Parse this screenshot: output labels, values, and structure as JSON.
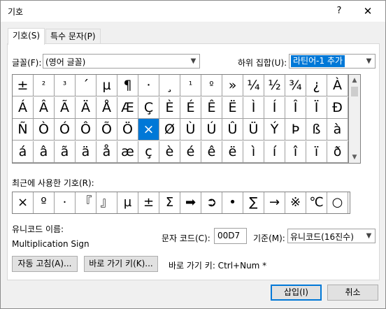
{
  "window": {
    "title": "기호",
    "help": "?",
    "close": "✕"
  },
  "tabs": [
    {
      "label": "기호(S)"
    },
    {
      "label": "특수 문자(P)"
    }
  ],
  "font": {
    "label": "글꼴(F):",
    "value": "(영어 글꼴)"
  },
  "subset": {
    "label": "하위 집합(U):",
    "value": "라틴어-1 추가"
  },
  "symbol_grid": {
    "rows": [
      [
        "±",
        "²",
        "³",
        "´",
        "µ",
        "¶",
        "·",
        "¸",
        "¹",
        "º",
        "»",
        "¼",
        "½",
        "¾",
        "¿",
        "À"
      ],
      [
        "Á",
        "Â",
        "Ã",
        "Ä",
        "Å",
        "Æ",
        "Ç",
        "È",
        "É",
        "Ê",
        "Ë",
        "Ì",
        "Í",
        "Î",
        "Ï",
        "Ð"
      ],
      [
        "Ñ",
        "Ò",
        "Ó",
        "Ô",
        "Õ",
        "Ö",
        "×",
        "Ø",
        "Ù",
        "Ú",
        "Û",
        "Ü",
        "Ý",
        "Þ",
        "ß",
        "à"
      ],
      [
        "á",
        "â",
        "ã",
        "ä",
        "å",
        "æ",
        "ç",
        "è",
        "é",
        "ê",
        "ë",
        "ì",
        "í",
        "î",
        "ï",
        "ð"
      ]
    ],
    "selected": "×"
  },
  "recent": {
    "label": "최근에 사용한 기호(R):",
    "items": [
      "×",
      "º",
      "·",
      "『",
      "』",
      "µ",
      "±",
      "Σ",
      "➡",
      "➲",
      "•",
      "∑",
      "→",
      "※",
      "℃",
      "○"
    ]
  },
  "unicode_name": {
    "label": "유니코드 이름:",
    "value": "Multiplication Sign"
  },
  "char_code": {
    "label": "문자 코드(C):",
    "value": "00D7"
  },
  "base": {
    "label": "기준(M):",
    "value": "유니코드(16진수)"
  },
  "buttons": {
    "autocorrect": "자동 고침(A)...",
    "shortcut_key": "바로 가기 키(K)...",
    "insert": "삽입(I)",
    "cancel": "취소"
  },
  "shortcut_text": "바로 가기 키: Ctrl+Num *"
}
